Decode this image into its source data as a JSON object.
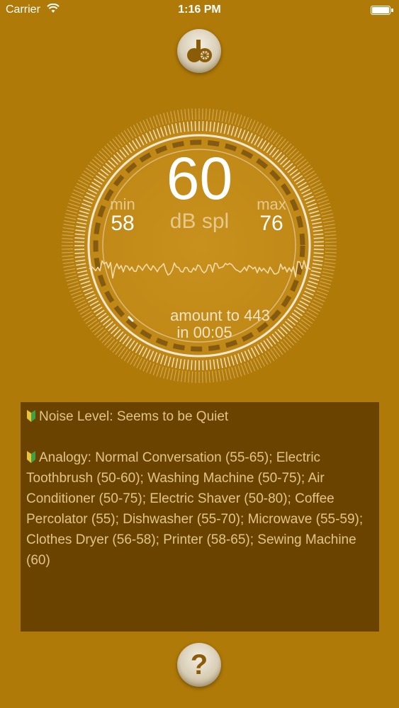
{
  "status_bar": {
    "carrier": "Carrier",
    "time": "1:16 PM"
  },
  "meter": {
    "reading": "60",
    "unit": "dB spl",
    "min_label": "min",
    "min_value": "58",
    "max_label": "max",
    "max_value": "76",
    "amount_line": "amount to 443",
    "time_line": "in 00:05",
    "colors": {
      "background": "#B07A08",
      "ring": "#f4e8cf",
      "waveform": "#f4dca7"
    }
  },
  "info": {
    "noise_level": "Noise Level: Seems to be Quiet",
    "analogy": "Analogy: Normal Conversation (55-65); Electric Toothbrush (50-60); Washing Machine (50-75); Air Conditioner (50-75); Electric Shaver (50-80); Coffee Percolator (55); Dishwasher (55-70); Microwave (55-59); Clothes Dryer (56-58); Printer (58-65); Sewing Machine (60)"
  },
  "buttons": {
    "logo_icon": "app-logo-icon",
    "help_label": "?"
  }
}
